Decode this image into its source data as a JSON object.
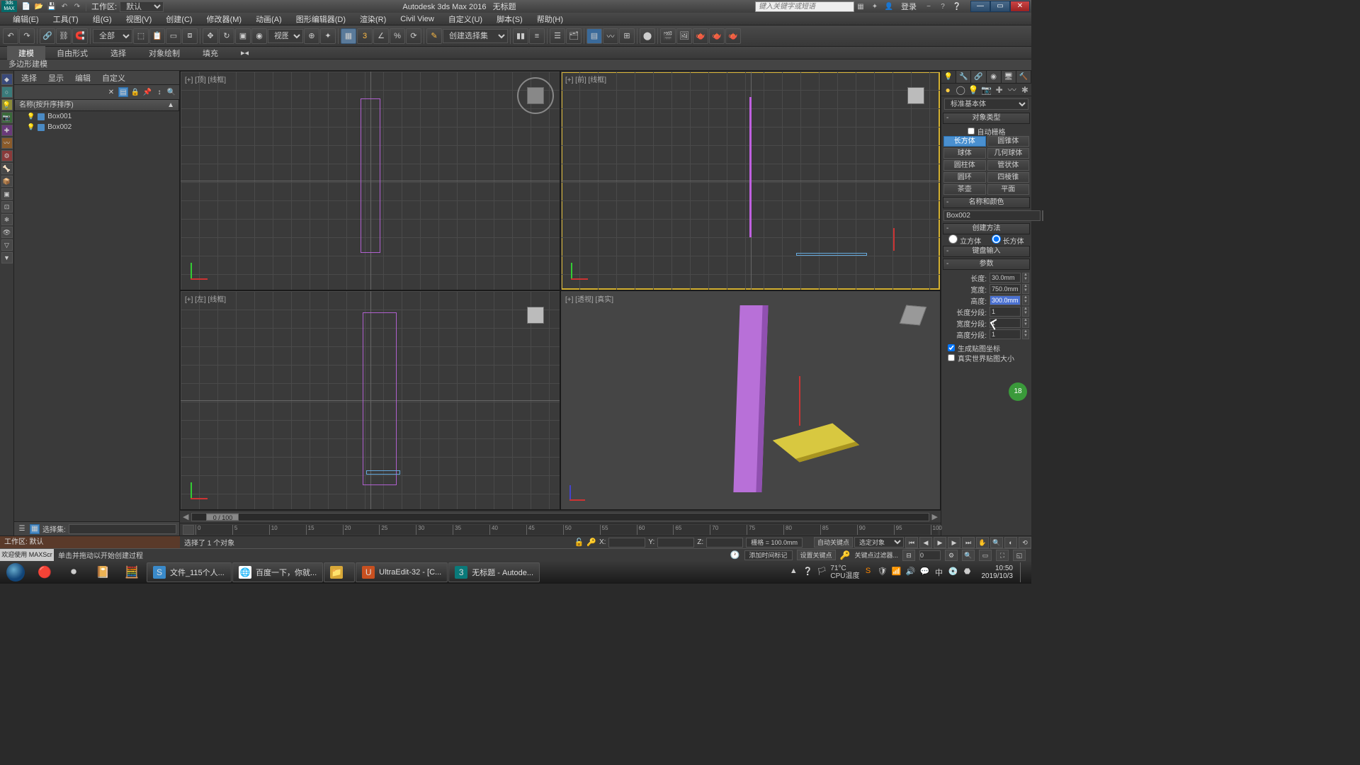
{
  "title": {
    "app": "Autodesk 3ds Max 2016",
    "doc": "无标题"
  },
  "workspace": {
    "lbl": "工作区:",
    "val": "默认"
  },
  "search_ph": "键入关键字或短语",
  "login": "登录",
  "menu": [
    "编辑(E)",
    "工具(T)",
    "组(G)",
    "视图(V)",
    "创建(C)",
    "修改器(M)",
    "动画(A)",
    "图形编辑器(D)",
    "渲染(R)",
    "Civil View",
    "自定义(U)",
    "脚本(S)",
    "帮助(H)"
  ],
  "tb": {
    "all": "全部",
    "view": "视图",
    "select_set": "创建选择集"
  },
  "ribbon": {
    "tabs": [
      "建模",
      "自由形式",
      "选择",
      "对象绘制",
      "填充"
    ],
    "sub": "多边形建模"
  },
  "explorer": {
    "tabs": [
      "选择",
      "显示",
      "编辑",
      "自定义"
    ],
    "hdr": "名称(按升序排序)",
    "items": [
      "Box001",
      "Box002"
    ],
    "set_lbl": "选择集:"
  },
  "vp": {
    "tl": "[+] [顶] [线框]",
    "tr": "[+] [前] [线框]",
    "bl": "[+] [左] [线框]",
    "br": "[+] [透视] [真实]"
  },
  "slider": "0 / 100",
  "ruler": [
    0,
    5,
    10,
    15,
    20,
    25,
    30,
    35,
    40,
    45,
    50,
    55,
    60,
    65,
    70,
    75,
    80,
    85,
    90,
    95,
    100
  ],
  "cmd": {
    "dd": "标准基本体",
    "r_objtype": "对象类型",
    "autogrid": "自动栅格",
    "prims": [
      [
        "长方体",
        "圆锥体"
      ],
      [
        "球体",
        "几何球体"
      ],
      [
        "圆柱体",
        "管状体"
      ],
      [
        "圆环",
        "四棱锥"
      ],
      [
        "茶壶",
        "平面"
      ]
    ],
    "r_name": "名称和颜色",
    "name": "Box002",
    "r_create": "创建方法",
    "rad1": "立方体",
    "rad2": "长方体",
    "r_kb": "键盘输入",
    "r_params": "参数",
    "p": [
      {
        "l": "长度:",
        "v": "30.0mm"
      },
      {
        "l": "宽度:",
        "v": "750.0mm"
      },
      {
        "l": "高度:",
        "v": "300.0mm",
        "sel": true
      },
      {
        "l": "长度分段:",
        "v": "1"
      },
      {
        "l": "宽度分段:",
        "v": "1"
      },
      {
        "l": "高度分段:",
        "v": "1"
      }
    ],
    "chk1": "生成贴图坐标",
    "chk2": "真实世界贴图大小"
  },
  "status": {
    "ws": "工作区: 默认",
    "sel": "选择了 1 个对象",
    "welcome": "欢迎使用  MAXScr",
    "hint": "单击并拖动以开始创建过程",
    "x": "X:",
    "y": "Y:",
    "z": "Z:",
    "grid": "栅格 = 100.0mm",
    "addtag": "添加时间标记",
    "autokey": "自动关键点",
    "setkey": "设置关键点",
    "keydd": "选定对象",
    "filter": "关键点过滤器..."
  },
  "taskbar": {
    "items": [
      {
        "ico": "📄",
        "t": "文件_115个人..."
      },
      {
        "ico": "🌐",
        "t": "百度一下，你就..."
      },
      {
        "ico": "📁",
        "t": ""
      },
      {
        "ico": "U",
        "t": "UltraEdit-32 - [C..."
      },
      {
        "ico": "3",
        "t": "无标题 - Autode..."
      }
    ],
    "temp1": "71°C",
    "temp2": "CPU温度",
    "time": "10:50",
    "date": "2019/10/3"
  }
}
